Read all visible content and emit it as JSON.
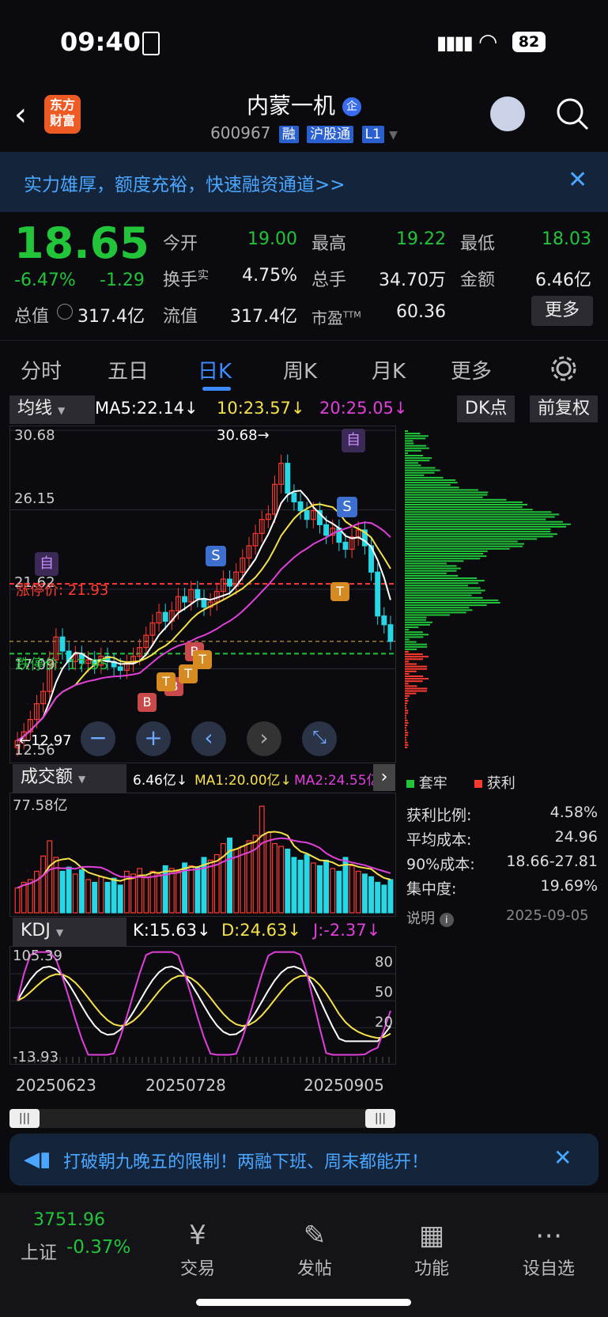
{
  "status": {
    "time": "09:40",
    "battery": "82"
  },
  "header": {
    "title": "内蒙一机",
    "badge": "企",
    "code": "600967",
    "tags": [
      "融",
      "沪股通",
      "L1"
    ],
    "logo_line1": "东方",
    "logo_line2": "财富"
  },
  "banner": {
    "text": "实力雄厚，额度充裕，快速融资通道>>"
  },
  "quote": {
    "price": "18.65",
    "change_pct": "-6.47%",
    "change": "-1.29",
    "open_label": "今开",
    "open": "19.00",
    "high_label": "最高",
    "high": "19.22",
    "low_label": "最低",
    "low": "18.03",
    "turnover_label": "换手",
    "turnover_sup": "实",
    "turnover": "4.75%",
    "volume_label": "总手",
    "volume": "34.70万",
    "amount_label": "金额",
    "amount": "6.46亿",
    "mktcap_label": "总值",
    "mktcap": "317.4亿",
    "float_label": "流值",
    "float": "317.4亿",
    "pe_label": "市盈",
    "pe_sup": "TTM",
    "pe": "60.36",
    "more": "更多"
  },
  "tabs": [
    "分时",
    "五日",
    "日K",
    "周K",
    "月K",
    "更多"
  ],
  "active_tab": "日K",
  "kline_header": {
    "selector": "均线",
    "ma5": "MA5:22.14↓",
    "ma10": "10:23.57↓",
    "ma20": "20:25.05↓",
    "dk": "DK点",
    "adjust": "前复权"
  },
  "kline": {
    "labels": {
      "top": "30.68",
      "mid": "26.15",
      "lvl": "21.62",
      "low": "17.09",
      "bottom": "12.56",
      "peak": "30.68→",
      "minmark": "←12.97"
    },
    "limit_up": "涨停价: 21.93",
    "limit_down": "跌停价: 17.95",
    "signals": [
      "自",
      "S",
      "S",
      "自",
      "B",
      "B",
      "B",
      "T",
      "T",
      "T",
      "T",
      "S"
    ]
  },
  "chart_data": {
    "type": "candlestick",
    "ylim": [
      12.56,
      30.68
    ],
    "closes": [
      13.0,
      13.5,
      14.2,
      15.1,
      15.8,
      17.6,
      18.9,
      18.1,
      17.5,
      17.9,
      17.4,
      17.6,
      17.3,
      17.8,
      17.5,
      17.2,
      17.0,
      17.4,
      17.8,
      18.3,
      19.0,
      19.7,
      20.3,
      19.8,
      20.4,
      21.2,
      20.9,
      21.6,
      21.1,
      20.6,
      20.9,
      21.5,
      22.2,
      21.8,
      22.6,
      23.4,
      24.1,
      24.8,
      25.6,
      25.9,
      27.6,
      28.8,
      27.1,
      26.6,
      26.1,
      25.6,
      26.1,
      25.3,
      24.7,
      25.1,
      24.3,
      23.9,
      24.6,
      25.0,
      24.1,
      22.6,
      20.1,
      19.6,
      18.65
    ]
  },
  "volume_panel": {
    "selector": "成交额",
    "value": "6.46亿↓",
    "ma1": "MA1:20.00亿↓",
    "ma2": "MA2:24.55亿",
    "max": "77.58亿"
  },
  "volume_data": [
    18,
    22,
    24,
    30,
    41,
    52,
    40,
    30,
    33,
    28,
    31,
    24,
    22,
    26,
    22,
    25,
    20,
    30,
    28,
    32,
    26,
    30,
    28,
    34,
    32,
    30,
    36,
    34,
    33,
    40,
    38,
    42,
    50,
    54,
    46,
    48,
    52,
    56,
    77,
    58,
    50,
    48,
    46,
    40,
    38,
    42,
    36,
    34,
    38,
    32,
    30,
    40,
    34,
    30,
    28,
    26,
    22,
    20,
    24
  ],
  "kdj_panel": {
    "selector": "KDJ",
    "k": "K:15.63↓",
    "d": "D:24.63↓",
    "j": "J:-2.37↓",
    "max": "105.39",
    "min": "-13.93",
    "lv80": "80",
    "lv50": "50",
    "lv20": "20"
  },
  "dates": [
    "20250623",
    "20250728",
    "20250905"
  ],
  "chips": {
    "legend_hold": "套牢",
    "legend_profit": "获利",
    "rows": [
      {
        "label": "获利比例:",
        "value": "4.58%"
      },
      {
        "label": "平均成本:",
        "value": "24.96"
      },
      {
        "label": "90%成本:",
        "value": "18.66-27.81"
      },
      {
        "label": "集中度:",
        "value": "19.69%"
      }
    ],
    "note": "说明",
    "date": "2025-09-05"
  },
  "ad": {
    "text": "打破朝九晚五的限制！两融下班、周末都能开！"
  },
  "nav": {
    "index_value": "3751.96",
    "index_name": "上证",
    "index_change": "-0.37%",
    "items": [
      "交易",
      "发帖",
      "功能",
      "设自选"
    ]
  },
  "colors": {
    "up": "#ff3b30",
    "down": "#22c43a",
    "cyan": "#26d7e6",
    "ma5": "#ffffff",
    "ma10": "#f5e14a",
    "ma20": "#e040d8"
  }
}
